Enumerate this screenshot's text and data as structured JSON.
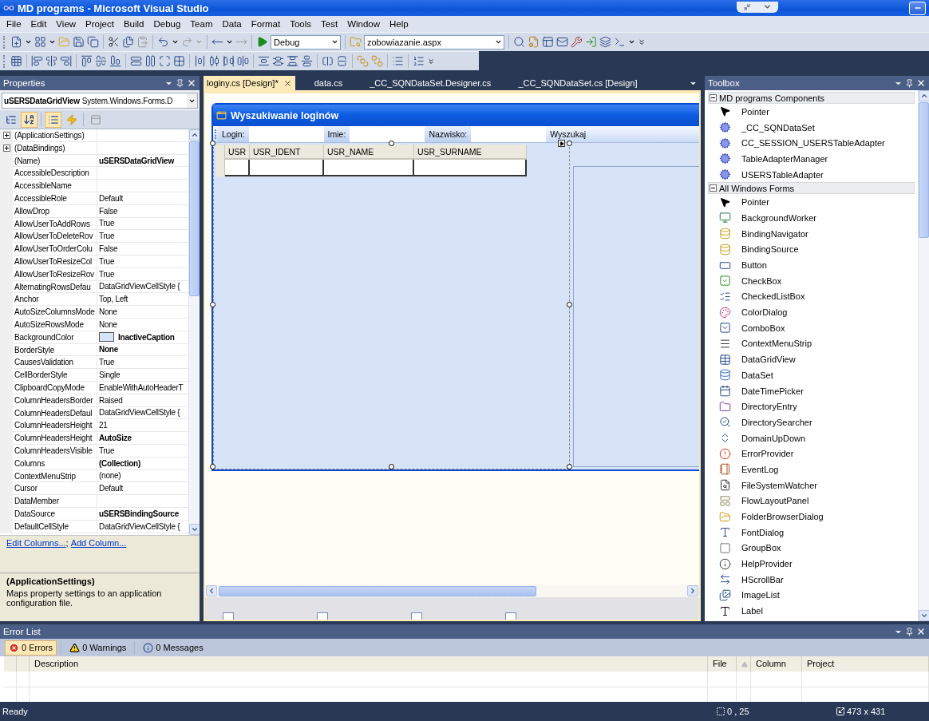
{
  "window": {
    "title": "MD programs - Microsoft Visual Studio"
  },
  "menu": [
    "File",
    "Edit",
    "View",
    "Project",
    "Build",
    "Debug",
    "Team",
    "Data",
    "Format",
    "Tools",
    "Test",
    "Window",
    "Help"
  ],
  "toolbar": {
    "configuration": "Debug",
    "startup_page": "zobowiazanie.aspx"
  },
  "properties": {
    "title": "Properties",
    "object_name": "uSERSDataGridView",
    "object_type": "System.Windows.Forms.D",
    "alphabetical": true,
    "events": false,
    "rows": [
      {
        "name": "(ApplicationSettings)",
        "value": "",
        "expandable": true
      },
      {
        "name": "(DataBindings)",
        "value": "",
        "expandable": true
      },
      {
        "name": "(Name)",
        "value": "uSERSDataGridView",
        "expandable": false,
        "bold": true
      },
      {
        "name": "AccessibleDescription",
        "value": "",
        "expandable": false
      },
      {
        "name": "AccessibleName",
        "value": "",
        "expandable": false
      },
      {
        "name": "AccessibleRole",
        "value": "Default",
        "expandable": false,
        "bold": false
      },
      {
        "name": "AllowDrop",
        "value": "False",
        "expandable": false,
        "bold": false
      },
      {
        "name": "AllowUserToAddRows",
        "value": "True",
        "expandable": false,
        "bold": false
      },
      {
        "name": "AllowUserToDeleteRov",
        "value": "True",
        "expandable": false,
        "bold": false
      },
      {
        "name": "AllowUserToOrderColu",
        "value": "False",
        "expandable": false,
        "bold": false
      },
      {
        "name": "AllowUserToResizeCol",
        "value": "True",
        "expandable": false,
        "bold": false
      },
      {
        "name": "AllowUserToResizeRov",
        "value": "True",
        "expandable": false,
        "bold": false
      },
      {
        "name": "AlternatingRowsDefau",
        "value": "DataGridViewCellStyle {",
        "expandable": false,
        "bold": false
      },
      {
        "name": "Anchor",
        "value": "Top, Left",
        "expandable": false,
        "bold": false
      },
      {
        "name": "AutoSizeColumnsMode",
        "value": "None",
        "expandable": false,
        "bold": false
      },
      {
        "name": "AutoSizeRowsMode",
        "value": "None",
        "expandable": false,
        "bold": false
      },
      {
        "name": "BackgroundColor",
        "value": "InactiveCaption",
        "expandable": false,
        "bold": true,
        "color": "#d7e3f7"
      },
      {
        "name": "BorderStyle",
        "value": "None",
        "expandable": false,
        "bold": true
      },
      {
        "name": "CausesValidation",
        "value": "True",
        "expandable": false,
        "bold": false
      },
      {
        "name": "CellBorderStyle",
        "value": "Single",
        "expandable": false,
        "bold": false
      },
      {
        "name": "ClipboardCopyMode",
        "value": "EnableWithAutoHeaderT",
        "expandable": false,
        "bold": false
      },
      {
        "name": "ColumnHeadersBorder",
        "value": "Raised",
        "expandable": false,
        "bold": false
      },
      {
        "name": "ColumnHeadersDefaul",
        "value": "DataGridViewCellStyle {",
        "expandable": false,
        "bold": false
      },
      {
        "name": "ColumnHeadersHeight",
        "value": "21",
        "expandable": false,
        "bold": false
      },
      {
        "name": "ColumnHeadersHeight",
        "value": "AutoSize",
        "expandable": false,
        "bold": true
      },
      {
        "name": "ColumnHeadersVisible",
        "value": "True",
        "expandable": false,
        "bold": false
      },
      {
        "name": "Columns",
        "value": "(Collection)",
        "expandable": false,
        "bold": true
      },
      {
        "name": "ContextMenuStrip",
        "value": "(none)",
        "expandable": false,
        "bold": false
      },
      {
        "name": "Cursor",
        "value": "Default",
        "expandable": false,
        "bold": false
      },
      {
        "name": "DataMember",
        "value": "",
        "expandable": false
      },
      {
        "name": "DataSource",
        "value": "uSERSBindingSource",
        "expandable": false,
        "bold": true
      },
      {
        "name": "DefaultCellStyle",
        "value": "DataGridViewCellStyle {",
        "expandable": false,
        "bold": false
      }
    ],
    "commands": [
      "Edit Columns...",
      "Add Column..."
    ],
    "command_separator": ";",
    "description": {
      "title": "(ApplicationSettings)",
      "text": "Maps property settings to an application configuration file."
    }
  },
  "document": {
    "tabs": [
      {
        "label": "loginy.cs [Design]*",
        "selected": true
      },
      {
        "label": "data.cs",
        "selected": false
      },
      {
        "label": "_CC_SQNDataSet.Designer.cs",
        "selected": false
      },
      {
        "label": "_CC_SQNDataSet.cs [Design]",
        "selected": false
      }
    ],
    "form": {
      "title": "Wyszukiwanie loginów",
      "toolstrip": [
        {
          "kind": "label",
          "text": "Login:"
        },
        {
          "kind": "textbox"
        },
        {
          "kind": "label",
          "text": "Imie:"
        },
        {
          "kind": "textbox"
        },
        {
          "kind": "label",
          "text": "Nazwisko:"
        },
        {
          "kind": "textbox"
        },
        {
          "kind": "button",
          "text": "Wyszukaj"
        }
      ],
      "grid_columns": [
        "USR",
        "USR_IDENT",
        "USR_NAME",
        "USR_SURNAME"
      ]
    }
  },
  "toolbox": {
    "title": "Toolbox",
    "groups": [
      {
        "title": "MD programs Components",
        "expanded": true,
        "items": [
          {
            "name": "Pointer",
            "kind": "pointer"
          },
          {
            "name": "_CC_SQNDataSet",
            "kind": "component"
          },
          {
            "name": "CC_SESSION_USERSTableAdapter",
            "kind": "component"
          },
          {
            "name": "TableAdapterManager",
            "kind": "component"
          },
          {
            "name": "USERSTableAdapter",
            "kind": "component"
          }
        ]
      },
      {
        "title": "All Windows Forms",
        "expanded": true,
        "items": [
          {
            "name": "Pointer",
            "kind": "pointer"
          },
          {
            "name": "BackgroundWorker",
            "kind": "control"
          },
          {
            "name": "BindingNavigator",
            "kind": "control"
          },
          {
            "name": "BindingSource",
            "kind": "control"
          },
          {
            "name": "Button",
            "kind": "control"
          },
          {
            "name": "CheckBox",
            "kind": "control"
          },
          {
            "name": "CheckedListBox",
            "kind": "control"
          },
          {
            "name": "ColorDialog",
            "kind": "control"
          },
          {
            "name": "ComboBox",
            "kind": "control"
          },
          {
            "name": "ContextMenuStrip",
            "kind": "control"
          },
          {
            "name": "DataGridView",
            "kind": "control"
          },
          {
            "name": "DataSet",
            "kind": "control"
          },
          {
            "name": "DateTimePicker",
            "kind": "control"
          },
          {
            "name": "DirectoryEntry",
            "kind": "control"
          },
          {
            "name": "DirectorySearcher",
            "kind": "control"
          },
          {
            "name": "DomainUpDown",
            "kind": "control"
          },
          {
            "name": "ErrorProvider",
            "kind": "control"
          },
          {
            "name": "EventLog",
            "kind": "control"
          },
          {
            "name": "FileSystemWatcher",
            "kind": "control"
          },
          {
            "name": "FlowLayoutPanel",
            "kind": "control"
          },
          {
            "name": "FolderBrowserDialog",
            "kind": "control"
          },
          {
            "name": "FontDialog",
            "kind": "control"
          },
          {
            "name": "GroupBox",
            "kind": "control"
          },
          {
            "name": "HelpProvider",
            "kind": "control"
          },
          {
            "name": "HScrollBar",
            "kind": "control"
          },
          {
            "name": "ImageList",
            "kind": "control"
          },
          {
            "name": "Label",
            "kind": "control"
          }
        ]
      }
    ]
  },
  "error_list": {
    "title": "Error List",
    "filters": [
      {
        "label": "0 Errors",
        "kind": "error",
        "selected": true
      },
      {
        "label": "0 Warnings",
        "kind": "warning",
        "selected": false
      },
      {
        "label": "0 Messages",
        "kind": "info",
        "selected": false
      }
    ],
    "columns": [
      "Description",
      "File",
      "Column",
      "Project"
    ]
  },
  "status_bar": {
    "text": "Ready",
    "position": "0 , 25",
    "size": "473 x 431"
  }
}
